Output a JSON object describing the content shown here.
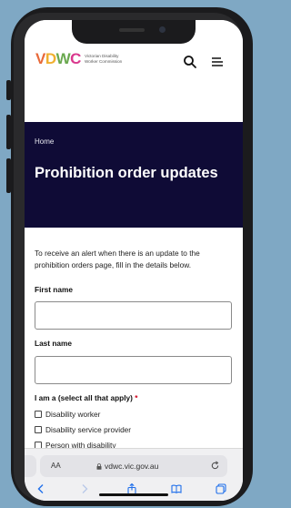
{
  "header": {
    "logo_letters": [
      "V",
      "D",
      "W",
      "C"
    ],
    "logo_org": "Victorian Disability Worker Commission",
    "search_icon": "search-icon",
    "menu_icon": "hamburger-menu-icon"
  },
  "hero": {
    "breadcrumb": "Home",
    "title": "Prohibition order updates"
  },
  "form": {
    "intro": "To receive an alert when there is an update to the prohibition orders page, fill in the details below.",
    "first_name_label": "First name",
    "first_name_value": "",
    "last_name_label": "Last name",
    "last_name_value": "",
    "role_label": "I am a (select all that apply)",
    "required_mark": "*",
    "roles": [
      "Disability worker",
      "Disability service provider",
      "Person with disability"
    ]
  },
  "browser": {
    "text_size": "AA",
    "url": "vdwc.vic.gov.au",
    "toolbar_icons": [
      "back-icon",
      "forward-icon",
      "share-icon",
      "bookmarks-icon",
      "tabs-icon"
    ]
  },
  "colors": {
    "hero_bg": "#0f0b36",
    "accent_blue": "#1f6feb",
    "required_red": "#d0021b"
  }
}
